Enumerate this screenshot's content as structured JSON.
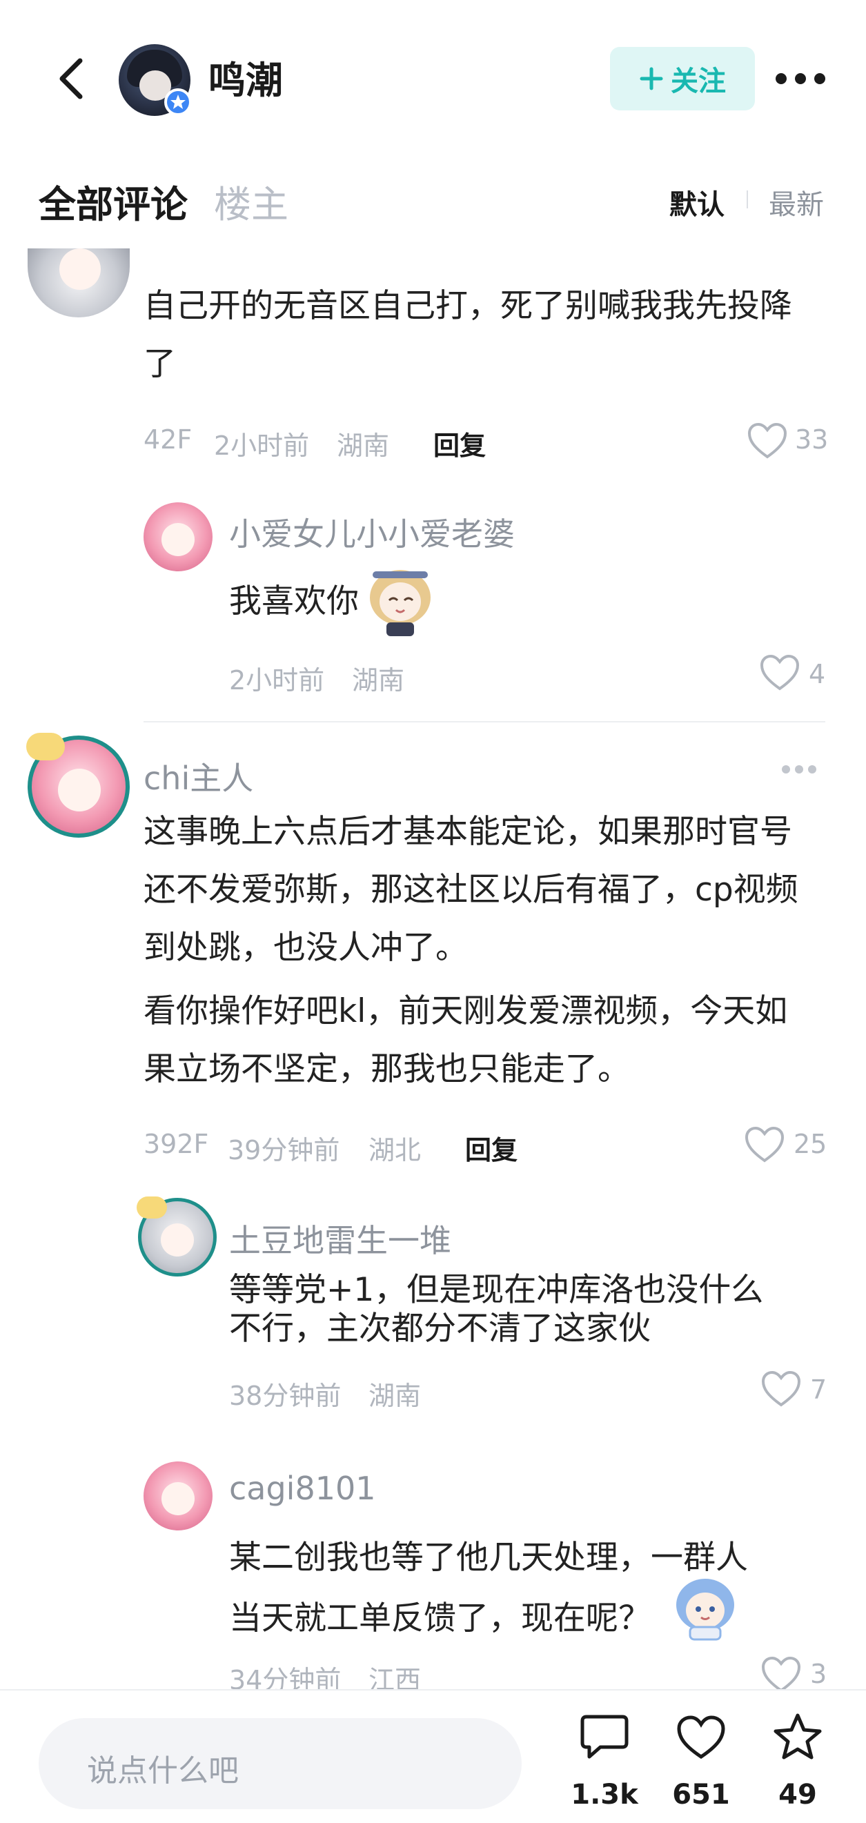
{
  "header": {
    "title": "鸣潮",
    "follow_label": "关注",
    "verified_icon": "star-badge-icon"
  },
  "tabs": {
    "all": "全部评论",
    "op": "楼主",
    "sort_default": "默认",
    "sort_newest": "最新"
  },
  "comments": [
    {
      "text_lines": [
        "自己开的无音区自己打，死了别喊我我先投降",
        "了"
      ],
      "floor": "42F",
      "time": "2小时前",
      "location": "湖南",
      "reply_label": "回复",
      "likes": "33",
      "replies": [
        {
          "username": "小爱女儿小小爱老婆",
          "text": "我喜欢你",
          "time": "2小时前",
          "location": "湖南",
          "likes": "4"
        }
      ]
    },
    {
      "username": "chi主人",
      "paragraph1": [
        "这事晚上六点后才基本能定论，如果那时官号",
        "还不发爱弥斯，那这社区以后有福了，cp视频",
        "到处跳，也没人冲了。"
      ],
      "paragraph2": [
        "看你操作好吧kl，前天刚发爱漂视频，今天如",
        "果立场不坚定，那我也只能走了。"
      ],
      "floor": "392F",
      "time": "39分钟前",
      "location": "湖北",
      "reply_label": "回复",
      "likes": "25",
      "replies": [
        {
          "username": "土豆地雷生一堆",
          "text_lines": [
            "等等党+1，但是现在冲库洛也没什么",
            "不行，主次都分不清了这家伙"
          ],
          "time": "38分钟前",
          "location": "湖南",
          "likes": "7"
        },
        {
          "username": "cagi8101",
          "text_lines": [
            "某二创我也等了他几天处理，一群人",
            "当天就工单反馈了，现在呢？"
          ],
          "time": "34分钟前",
          "location": "江西",
          "likes": "3"
        }
      ]
    }
  ],
  "bottom_bar": {
    "input_placeholder": "说点什么吧",
    "comments_count": "1.3k",
    "likes_count": "651",
    "favorites_count": "49"
  },
  "colors": {
    "accent_teal": "#19b8b0",
    "follow_bg": "#dff6f5",
    "muted_text": "#b0b5bd",
    "verify_blue": "#3d86f5"
  }
}
